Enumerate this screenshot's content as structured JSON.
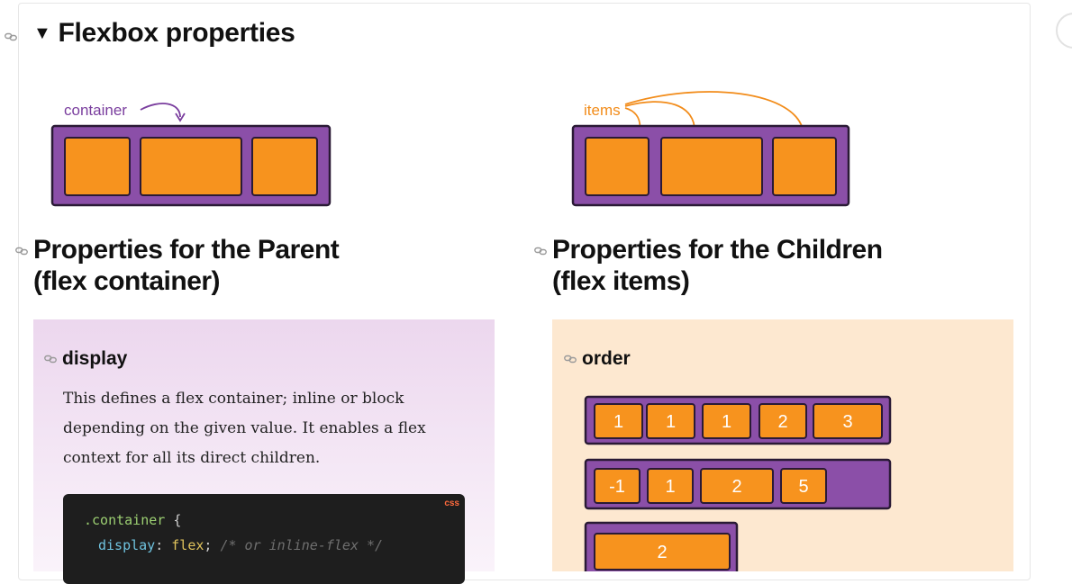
{
  "section": {
    "title": "Flexbox properties"
  },
  "illustrations": {
    "container_label": "container",
    "items_label": "items",
    "purple": "#8b4fa8",
    "orange": "#f7931e"
  },
  "parent": {
    "heading_line1": "Properties for the Parent",
    "heading_line2": "(flex container)",
    "panel": {
      "title": "display",
      "description": "This defines a flex container; inline or block depending on the given value. It enables a flex context for all its direct children.",
      "code_lang": "css",
      "code": {
        "selector": ".container",
        "open_brace": "{",
        "property": "display",
        "value": "flex",
        "comment": "/* or inline-flex */"
      }
    }
  },
  "children": {
    "heading_line1": "Properties for the Children",
    "heading_line2": "(flex items)",
    "panel": {
      "title": "order",
      "rows": [
        [
          "1",
          "1",
          "1",
          "2",
          "3"
        ],
        [
          "-1",
          "1",
          "2",
          "5"
        ],
        [
          "2"
        ]
      ]
    }
  }
}
